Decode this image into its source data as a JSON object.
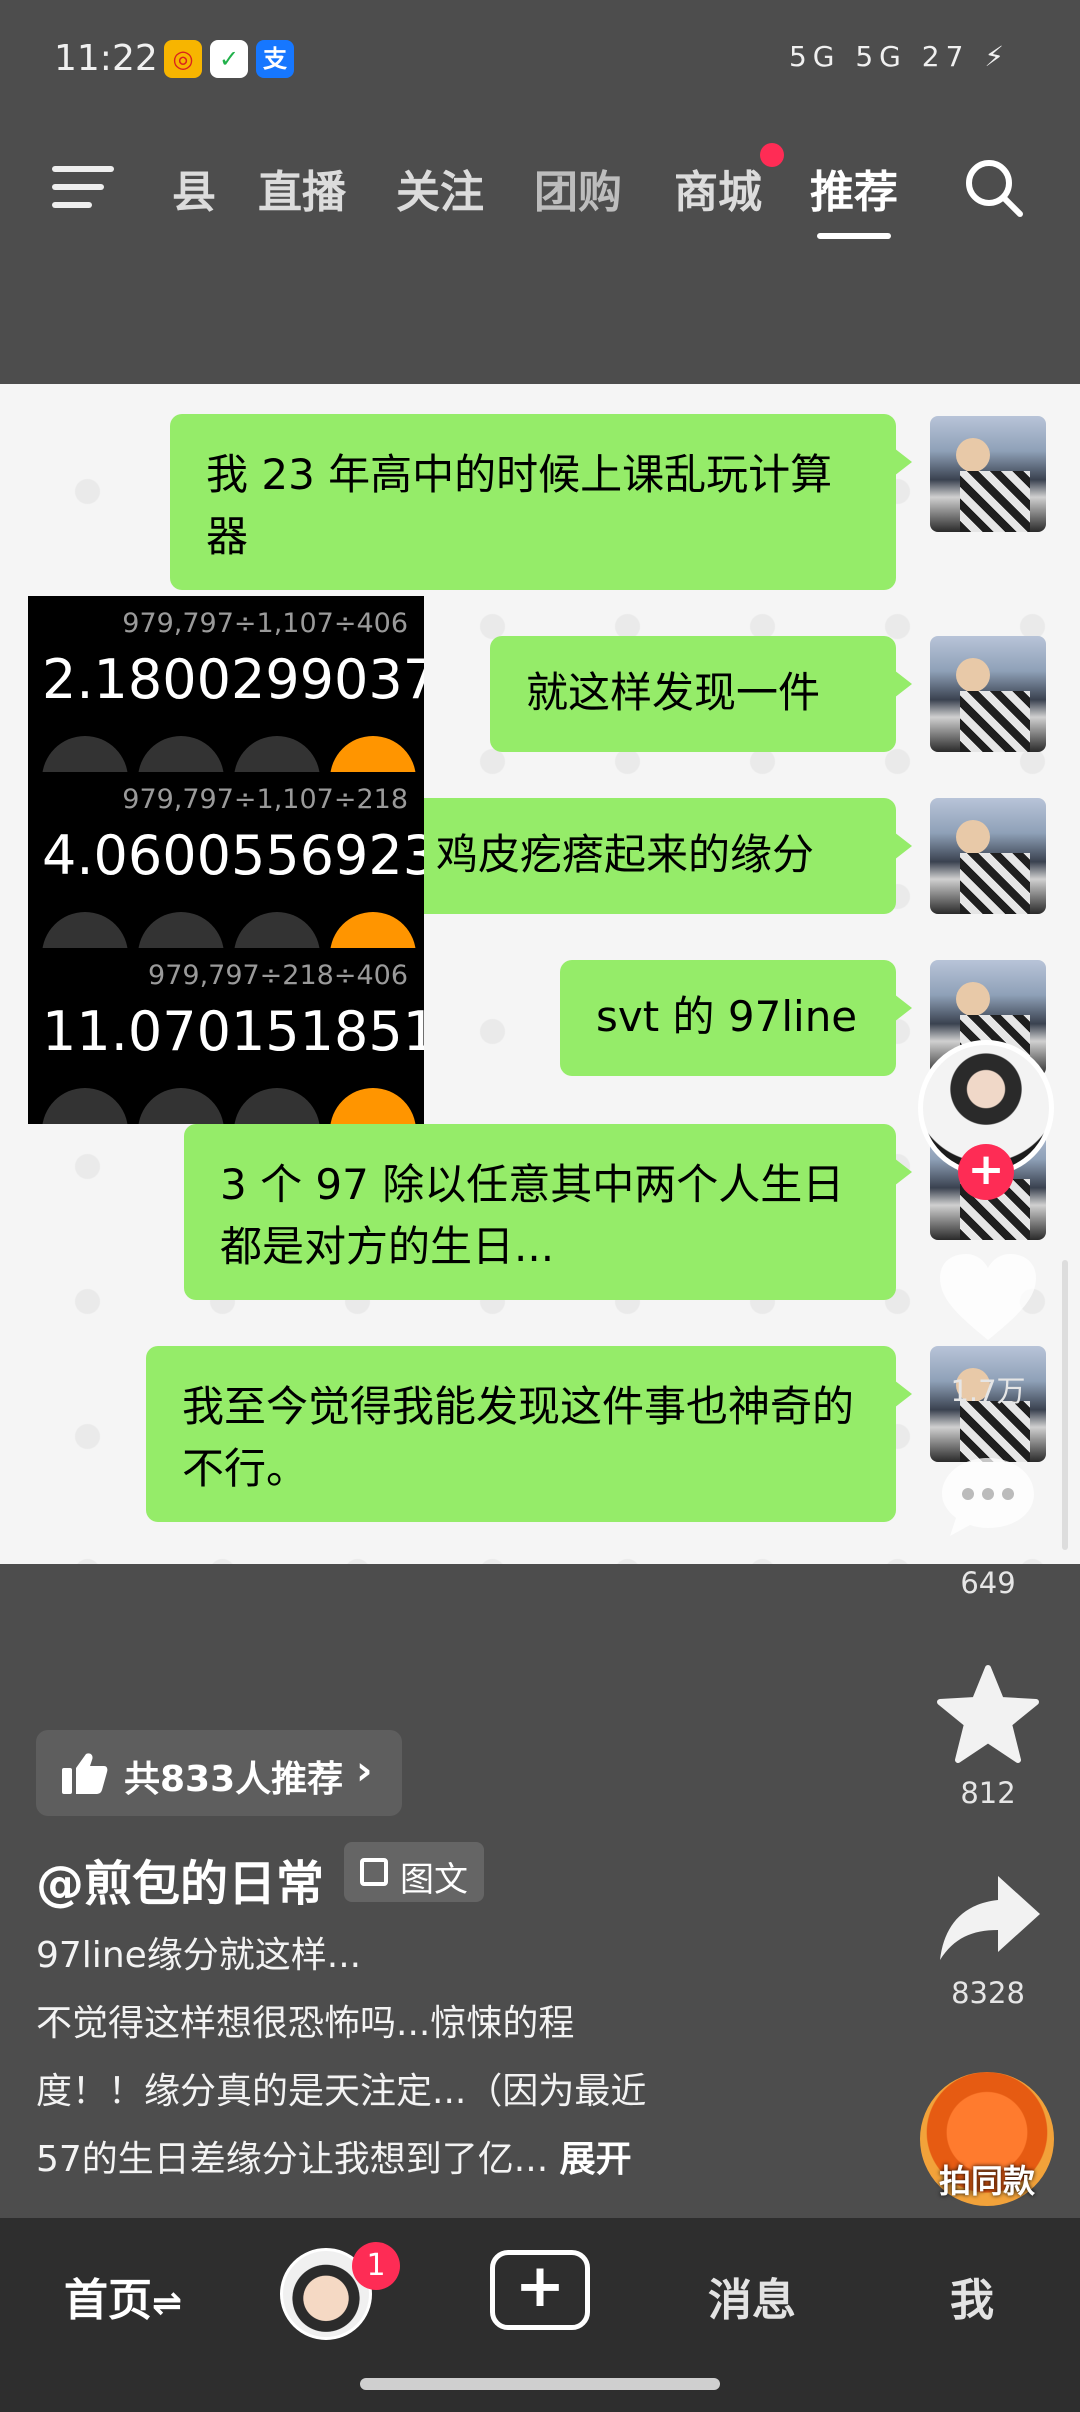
{
  "status_bar": {
    "time": "11:22",
    "app_icons": [
      {
        "name": "weibo-icon",
        "glyph": "◎",
        "bg": "#f7b500",
        "fg": "#d9231d"
      },
      {
        "name": "shield-icon",
        "glyph": "✓",
        "bg": "#ffffff",
        "fg": "#21b14b"
      },
      {
        "name": "alipay-icon",
        "glyph": "支",
        "bg": "#1677ff",
        "fg": "#ffffff"
      }
    ],
    "signal_text": "5G 5G",
    "battery": "27"
  },
  "top_nav": {
    "tabs": [
      "县",
      "直播",
      "关注",
      "团购",
      "商城",
      "推荐"
    ],
    "active_tab": "推荐",
    "accent": "#ff2c55"
  },
  "chat": {
    "messages": [
      "我 23 年高中的时候上课乱玩计算器",
      "就这样发现一件",
      "鸡皮疙瘩起来的缘分",
      "svt 的 97line",
      "3 个 97 除以任意其中两个人生日都是对方的生日...",
      "我至今觉得我能发现这件事也神奇的不行。"
    ],
    "calculators": [
      {
        "expression": "979,797÷1,107÷406",
        "result": "2.1800299037"
      },
      {
        "expression": "979,797÷1,107÷218",
        "result": "4.0600556923"
      },
      {
        "expression": "979,797÷218÷406",
        "result": "11.070151851"
      }
    ],
    "bubble_color": "#95ec69"
  },
  "right_rail": {
    "likes": "1.7万",
    "comments": "649",
    "favorites": "812",
    "shares": "8328",
    "music_label": "拍同款"
  },
  "post": {
    "recommend": "共833人推荐",
    "author": "@煎包的日常",
    "tag": "图文",
    "desc_lines": [
      "97line缘分就这样...",
      "不觉得这样想很恐怖吗...惊悚的程",
      "度！！缘分真的是天注定...（因为最近",
      "57的生日差缘分让我想到了亿..."
    ],
    "expand": "展开"
  },
  "bottom_nav": {
    "home": "首页",
    "messages": "消息",
    "me": "我",
    "badge": "1"
  }
}
